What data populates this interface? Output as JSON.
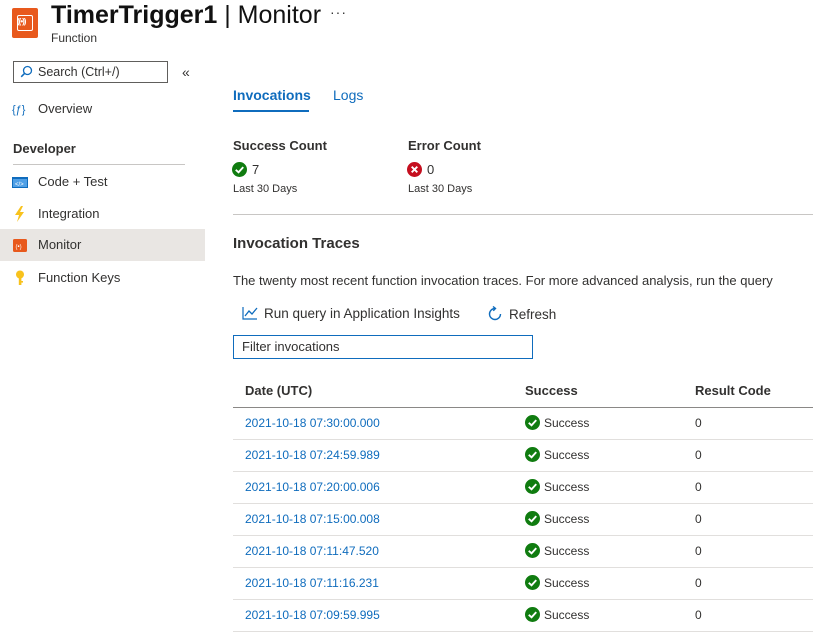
{
  "header": {
    "title_main": "TimerTrigger1",
    "title_sep": " | Monitor",
    "subtitle": "Function",
    "more": "···"
  },
  "sidebar": {
    "search_placeholder": "Search (Ctrl+/)",
    "collapse_icon": "«",
    "overview_label": "Overview",
    "section_developer": "Developer",
    "items": [
      {
        "label": "Code + Test",
        "icon": "code-icon"
      },
      {
        "label": "Integration",
        "icon": "lightning-icon"
      },
      {
        "label": "Monitor",
        "icon": "monitor-icon",
        "selected": true
      },
      {
        "label": "Function Keys",
        "icon": "key-icon"
      }
    ]
  },
  "tabs": [
    {
      "label": "Invocations",
      "active": true
    },
    {
      "label": "Logs",
      "active": false
    }
  ],
  "metrics": {
    "success": {
      "title": "Success Count",
      "value": "7",
      "period": "Last 30 Days"
    },
    "error": {
      "title": "Error Count",
      "value": "0",
      "period": "Last 30 Days"
    }
  },
  "traces": {
    "title": "Invocation Traces",
    "description": "The twenty most recent function invocation traces. For more advanced analysis, run the query",
    "run_query_label": "Run query in Application Insights",
    "refresh_label": "Refresh",
    "filter_placeholder": "Filter invocations",
    "columns": [
      "Date (UTC)",
      "Success",
      "Result Code"
    ],
    "rows": [
      {
        "date": "2021-10-18 07:30:00.000",
        "status": "Success",
        "code": "0"
      },
      {
        "date": "2021-10-18 07:24:59.989",
        "status": "Success",
        "code": "0"
      },
      {
        "date": "2021-10-18 07:20:00.006",
        "status": "Success",
        "code": "0"
      },
      {
        "date": "2021-10-18 07:15:00.008",
        "status": "Success",
        "code": "0"
      },
      {
        "date": "2021-10-18 07:11:47.520",
        "status": "Success",
        "code": "0"
      },
      {
        "date": "2021-10-18 07:11:16.231",
        "status": "Success",
        "code": "0"
      },
      {
        "date": "2021-10-18 07:09:59.995",
        "status": "Success",
        "code": "0"
      }
    ]
  },
  "colors": {
    "accent": "#0f6cbd",
    "success": "#107c10",
    "error": "#c50f1f",
    "brand": "#e8591d"
  }
}
